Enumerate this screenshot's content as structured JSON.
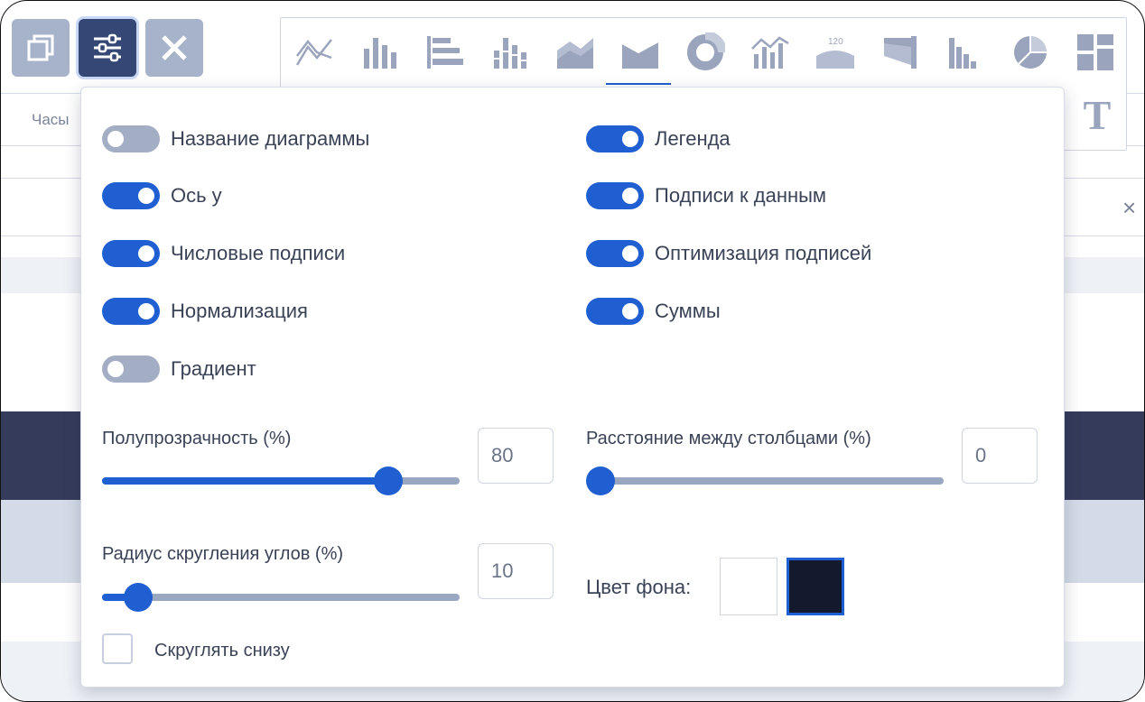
{
  "toolbar": {
    "copy_icon": "copy-icon",
    "settings_icon": "sliders-icon",
    "close_icon": "close-icon"
  },
  "background": {
    "tab_label": "Часы",
    "close_symbol": "×"
  },
  "chart_types": [
    {
      "name": "line-chart-icon"
    },
    {
      "name": "bar-chart-icon"
    },
    {
      "name": "horizontal-bar-chart-icon"
    },
    {
      "name": "stacked-bar-chart-icon"
    },
    {
      "name": "area-chart-icon"
    },
    {
      "name": "stacked-area-chart-icon",
      "active": true
    },
    {
      "name": "donut-chart-icon"
    },
    {
      "name": "combo-chart-icon"
    },
    {
      "name": "gauge-chart-icon",
      "badge": "120"
    },
    {
      "name": "funnel-chart-icon"
    },
    {
      "name": "histogram-chart-icon"
    },
    {
      "name": "pie-chart-icon"
    },
    {
      "name": "treemap-chart-icon"
    }
  ],
  "text_tool": "T",
  "settings": {
    "toggles_left": [
      {
        "label": "Название диаграммы",
        "on": false
      },
      {
        "label": "Ось y",
        "on": true
      },
      {
        "label": "Числовые подписи",
        "on": true
      },
      {
        "label": "Нормализация",
        "on": true
      },
      {
        "label": "Градиент",
        "on": false
      }
    ],
    "toggles_right": [
      {
        "label": "Легенда",
        "on": true
      },
      {
        "label": "Подписи к данным",
        "on": true
      },
      {
        "label": "Оптимизация подписей",
        "on": true
      },
      {
        "label": "Суммы",
        "on": true
      }
    ],
    "opacity": {
      "label": "Полупрозрачность (%)",
      "value": "80",
      "percent": 80
    },
    "bar_gap": {
      "label": "Расстояние между столбцами (%)",
      "value": "0",
      "percent": 0
    },
    "corner_radius": {
      "label": "Радиус скругления углов (%)",
      "value": "10",
      "percent": 10
    },
    "round_bottom": {
      "label": "Скруглять снизу",
      "checked": false
    },
    "background_color": {
      "label": "Цвет фона:",
      "swatches": [
        "#ffffff",
        "#141a2e"
      ],
      "selected": 1
    }
  },
  "colors": {
    "accent": "#1f5fd1",
    "header_band": "#353b5a",
    "light_band": "#d3dbe8"
  }
}
